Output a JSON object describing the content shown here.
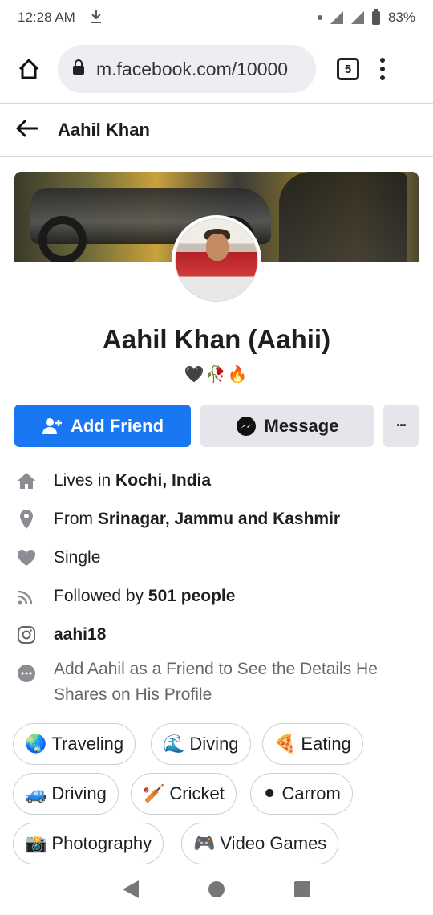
{
  "status_bar": {
    "time": "12:28 AM",
    "battery": "83%"
  },
  "browser": {
    "url": "m.facebook.com/10000",
    "tab_count": "5"
  },
  "header": {
    "title": "Aahil Khan"
  },
  "profile": {
    "name": "Aahil Khan (Aahii)",
    "emojis": "🖤🥀🔥"
  },
  "actions": {
    "add_friend": "Add Friend",
    "message": "Message",
    "more": "···"
  },
  "details": {
    "lives_prefix": "Lives in ",
    "lives_city": "Kochi, India",
    "from_prefix": "From ",
    "from_city": "Srinagar, Jammu and Kashmir",
    "relationship": "Single",
    "followed_prefix": "Followed by ",
    "followed_count": "501 people",
    "instagram": "aahi18",
    "add_note": "Add Aahil as a Friend to See the Details He Shares on His Profile"
  },
  "interests": [
    {
      "emoji": "🌏",
      "label": "Traveling"
    },
    {
      "emoji": "🌊",
      "label": "Diving"
    },
    {
      "emoji": "🍕",
      "label": "Eating"
    },
    {
      "emoji": "🚙",
      "label": "Driving"
    },
    {
      "emoji": "🏏",
      "label": "Cricket"
    },
    {
      "emoji": "⚫",
      "label": "Carrom"
    },
    {
      "emoji": "📸",
      "label": "Photography"
    },
    {
      "emoji": "🎮",
      "label": "Video Games"
    }
  ],
  "colors": {
    "primary": "#1a77f2",
    "secondary_bg": "#e4e6eb",
    "muted_text": "#65676b"
  }
}
